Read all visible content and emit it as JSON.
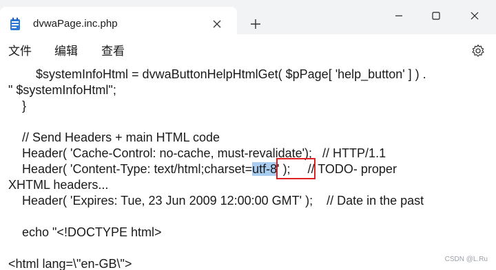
{
  "window": {
    "tab_title": "dvwaPage.inc.php",
    "app_icon": "notepad-icon"
  },
  "menu": {
    "file": "文件",
    "edit": "编辑",
    "view": "查看"
  },
  "editor": {
    "lines": [
      "        $systemInfoHtml = dvwaButtonHelpHtmlGet( $pPage[ 'help_button' ] ) .",
      "\" $systemInfoHtml\";",
      "    }",
      "",
      "    // Send Headers + main HTML code",
      "    Header( 'Cache-Control: no-cache, must-revalidate');   // HTTP/1.1",
      "    Header( 'Content-Type: text/html;charset=",
      "utf-8",
      "' );     // TODO- proper",
      "XHTML headers...",
      "    Header( 'Expires: Tue, 23 Jun 2009 12:00:00 GMT' );    // Date in the past",
      "",
      "    echo \"<!DOCTYPE html>",
      "",
      "<html lang=\\\"en-GB\\\">"
    ],
    "highlight_color": "#a8cdf0",
    "annotation_box_color": "#e02020"
  },
  "watermark": "CSDN @L.Ru"
}
